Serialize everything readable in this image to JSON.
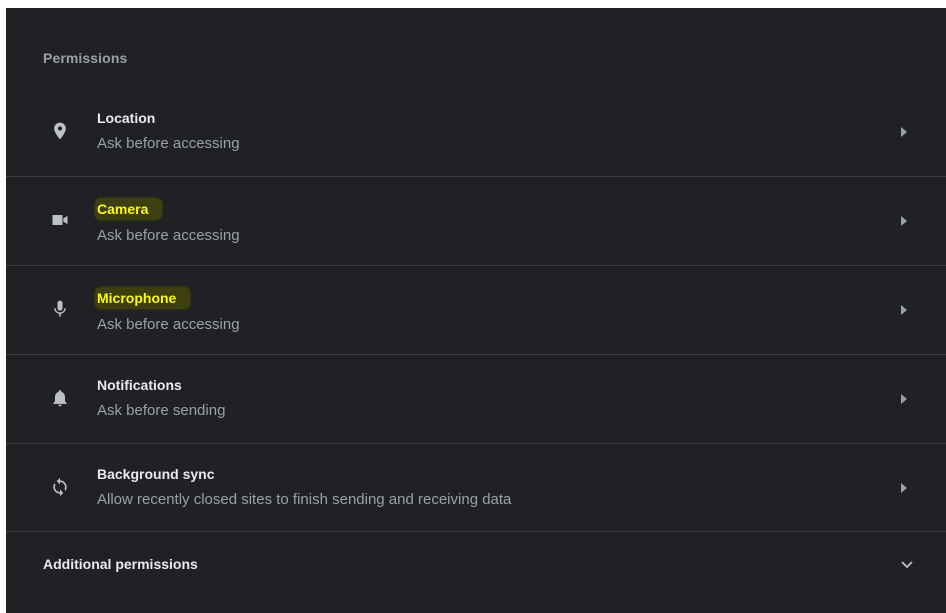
{
  "section": {
    "title": "Permissions"
  },
  "permissions": [
    {
      "icon": "location-pin-icon",
      "title": "Location",
      "subtitle": "Ask before accessing",
      "highlighted": false
    },
    {
      "icon": "camera-icon",
      "title": "Camera",
      "subtitle": "Ask before accessing",
      "highlighted": true
    },
    {
      "icon": "microphone-icon",
      "title": "Microphone",
      "subtitle": "Ask before accessing",
      "highlighted": true
    },
    {
      "icon": "bell-icon",
      "title": "Notifications",
      "subtitle": "Ask before sending",
      "highlighted": false
    },
    {
      "icon": "sync-icon",
      "title": "Background sync",
      "subtitle": "Allow recently closed sites to finish sending and receiving data",
      "highlighted": false
    }
  ],
  "additional": {
    "label": "Additional permissions",
    "icon": "chevron-down-icon"
  },
  "colors": {
    "background": "#202124",
    "divider": "#3c4043",
    "highlight_text": "#fcf91a",
    "highlight_bg": "#3d3f10"
  }
}
